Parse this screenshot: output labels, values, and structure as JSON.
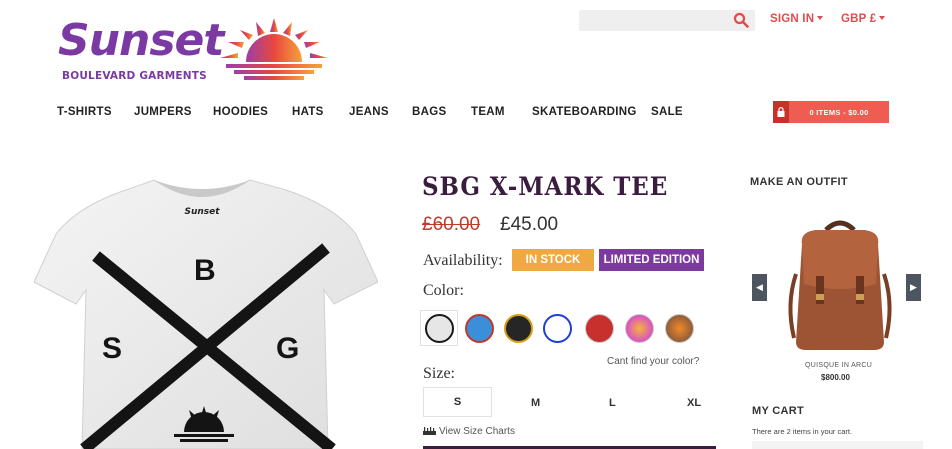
{
  "brand": {
    "name": "Sunset",
    "tagline": "BOULEVARD GARMENTS"
  },
  "header": {
    "search": {
      "placeholder": "",
      "icon": "search-icon"
    },
    "sign_in": "SIGN IN",
    "currency": "GBP £",
    "accent_color": "#e04b4b"
  },
  "nav": {
    "items": [
      "T-SHIRTS",
      "JUMPERS",
      "HOODIES",
      "HATS",
      "JEANS",
      "BAGS",
      "TEAM",
      "SKATEBOARDING",
      "SALE"
    ],
    "cart_label": "0 ITEMS - $0.00"
  },
  "product": {
    "title": "SBG X-MARK TEE",
    "price_old": "£60.00",
    "price_new": "£45.00",
    "availability_label": "Availability:",
    "badges": [
      {
        "text": "IN STOCK",
        "color": "#f0a843"
      },
      {
        "text": "LIMITED EDITION",
        "color": "#7d3a9e"
      }
    ],
    "color_label": "Color:",
    "colors": [
      "#e6e6e6",
      "#3b8fd9",
      "#262626",
      "#ffffff",
      "#c8302e",
      "#d44cd0",
      "#8a5a3a"
    ],
    "color_hint": "Cant find your color?",
    "size_label": "Size:",
    "sizes": [
      "S",
      "M",
      "L",
      "XL"
    ],
    "selected_size": "S",
    "size_chart_link": "View Size Charts",
    "shirt_letters": [
      "B",
      "S",
      "G"
    ],
    "shirt_logo": "Sunset"
  },
  "sidebar": {
    "outfit_heading": "MAKE AN OUTFIT",
    "outfit_item": {
      "name": "QUISQUE IN ARCU",
      "price": "$800.00"
    },
    "cart_heading": "MY CART",
    "cart_text": "There are 2 items in your cart."
  }
}
